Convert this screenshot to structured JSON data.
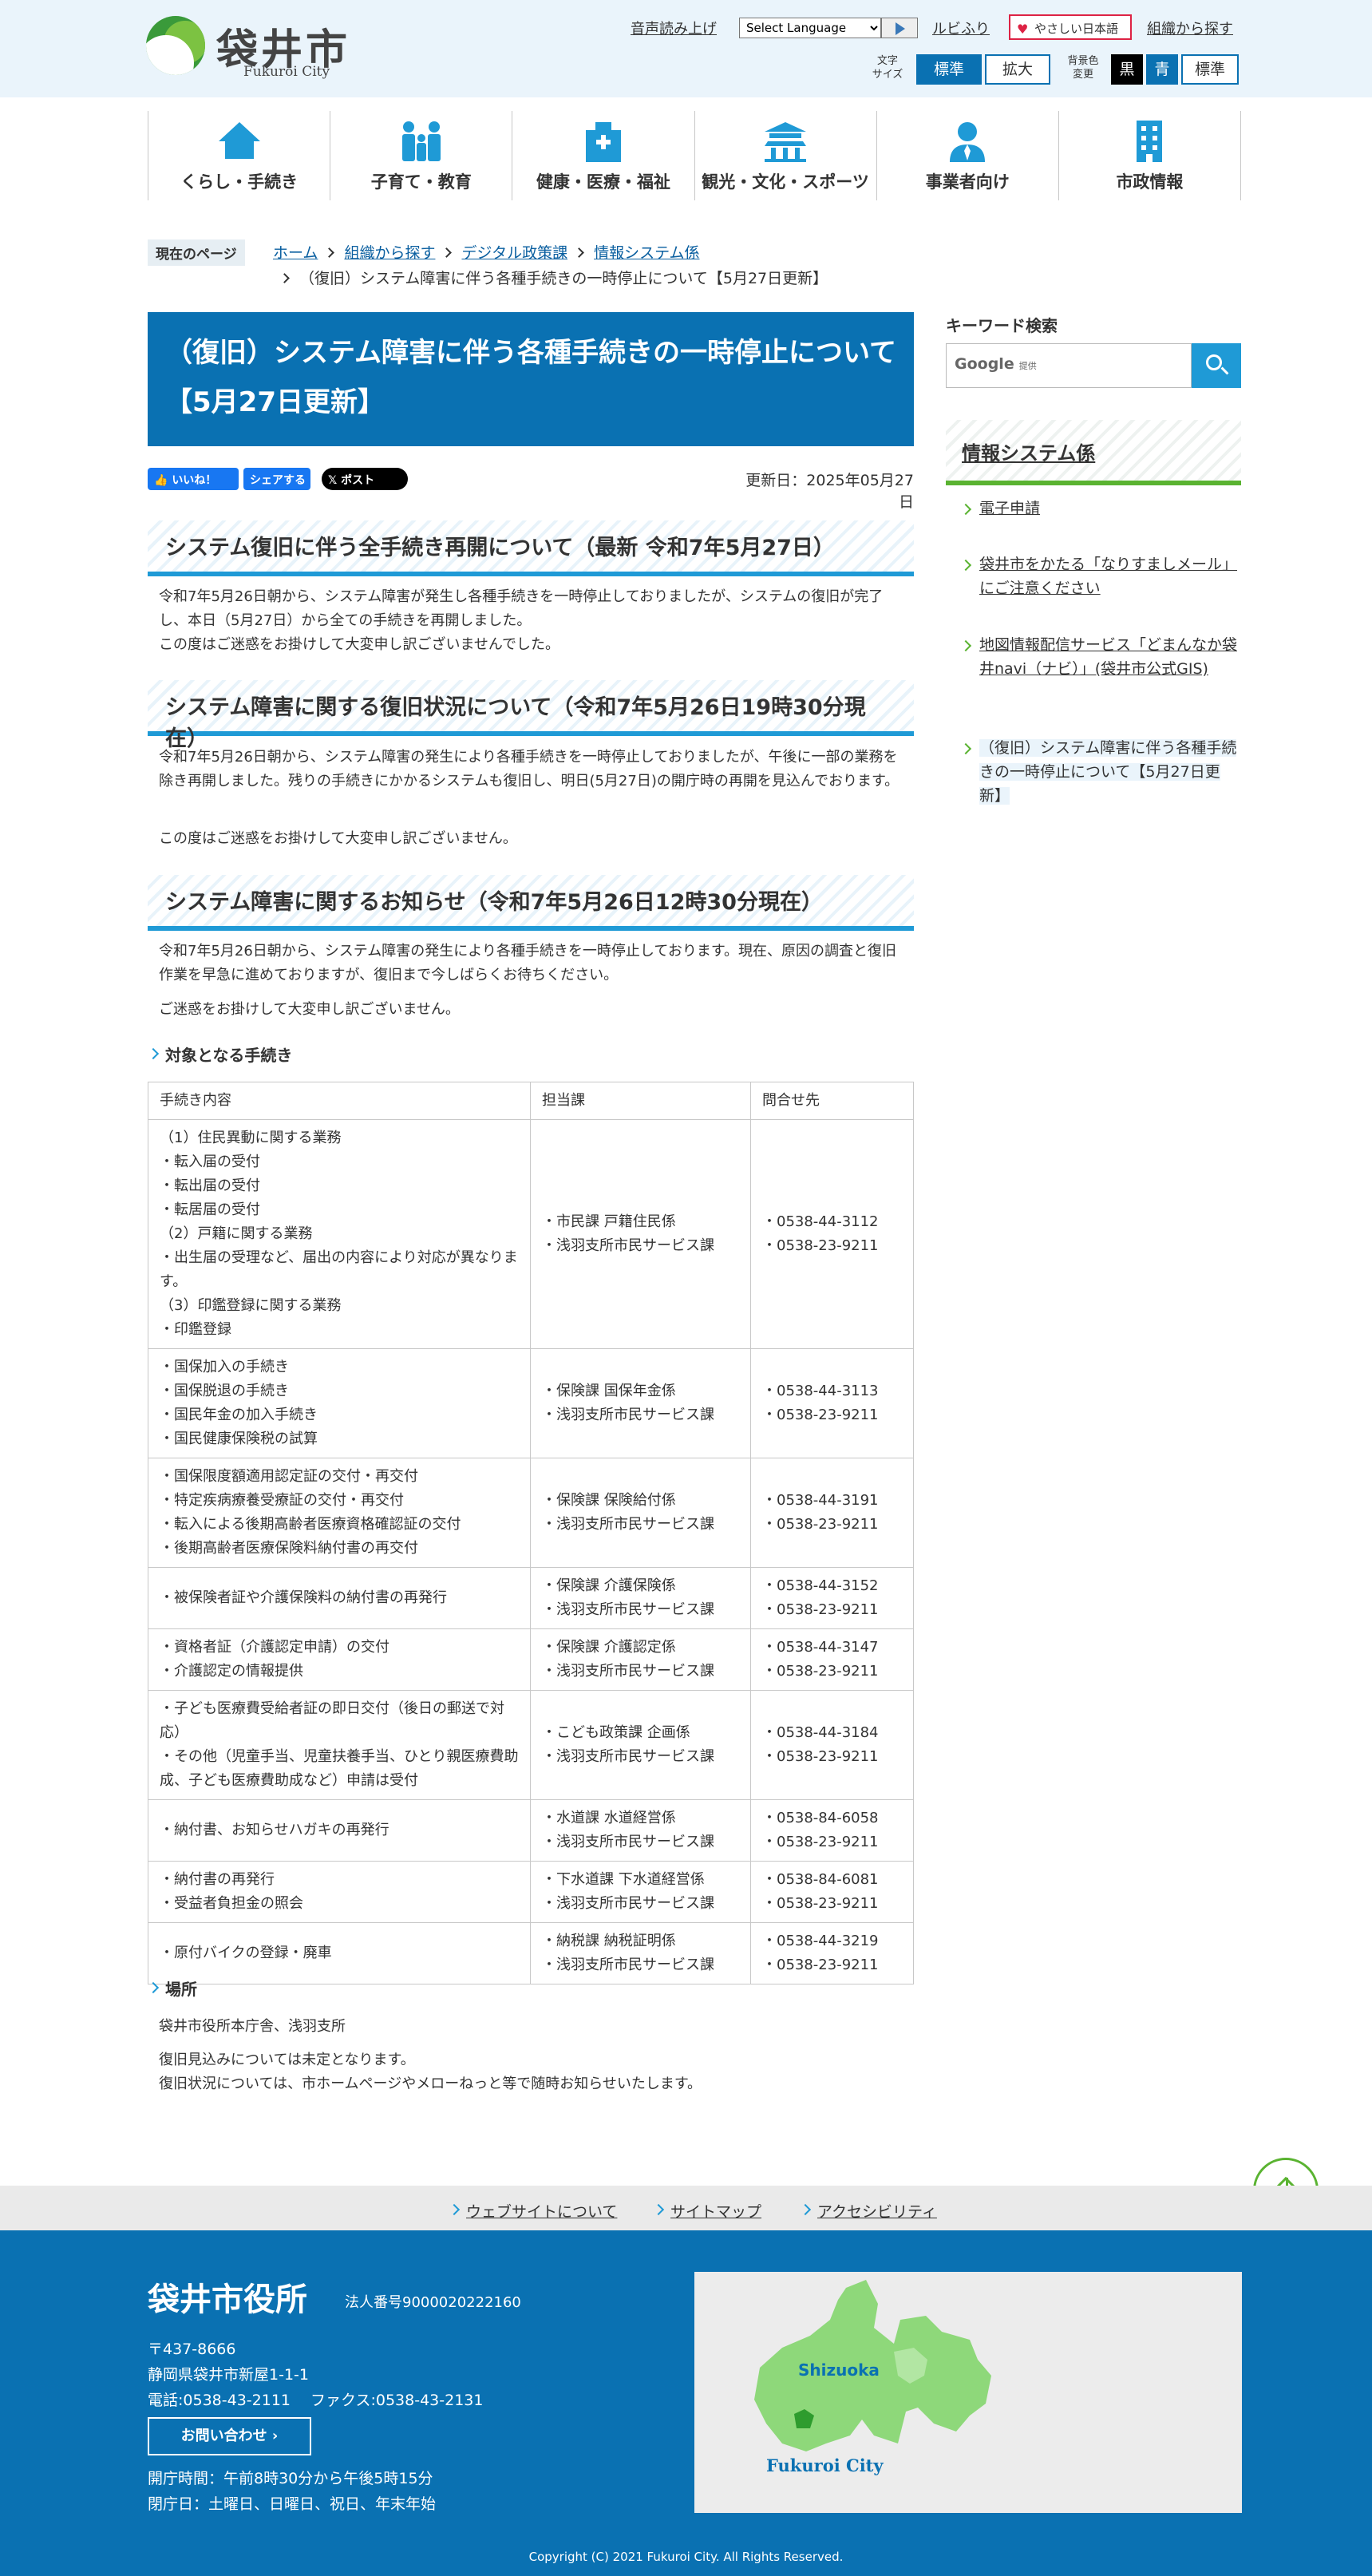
{
  "header": {
    "logo_name": "袋井市",
    "logo_sub": "Fukuroi City",
    "voice": "音声読み上げ",
    "language_select": "Select Language",
    "ruby": "ルビふり",
    "yasashii": "やさしい日本語",
    "org_search": "組織から探す",
    "font_size_label": "文字\nサイズ",
    "font_standard": "標準",
    "font_large": "拡大",
    "bg_label": "背景色\n変更",
    "bg_black": "黒",
    "bg_blue": "青",
    "bg_standard": "標準"
  },
  "nav": [
    {
      "label": "くらし・手続き",
      "icon": "house-icon"
    },
    {
      "label": "子育て・教育",
      "icon": "family-icon"
    },
    {
      "label": "健康・医療・福祉",
      "icon": "hospital-icon"
    },
    {
      "label": "観光・文化・スポーツ",
      "icon": "temple-icon"
    },
    {
      "label": "事業者向け",
      "icon": "businessperson-icon"
    },
    {
      "label": "市政情報",
      "icon": "building-icon"
    }
  ],
  "breadcrumb": {
    "tag": "現在のページ",
    "items": [
      "ホーム",
      "組織から探す",
      "デジタル政策課",
      "情報システム係"
    ],
    "current": "（復旧）システム障害に伴う各種手続きの一時停止について【5月27日更新】"
  },
  "page": {
    "title": "（復旧）システム障害に伴う各種手続きの一時停止について【5月27日更新】",
    "like": "いいね！",
    "share": "シェアする",
    "post": "ポスト",
    "updated": "更新日：2025年05月27日"
  },
  "sections": [
    {
      "heading": "システム復旧に伴う全手続き再開について（最新 令和7年5月27日）",
      "paragraphs": [
        "令和7年5月26日朝から、システム障害が発生し各種手続きを一時停止しておりましたが、システムの復旧が完了し、本日（5月27日）から全ての手続きを再開しました。\nこの度はご迷惑をお掛けして大変申し訳ございませんでした。"
      ]
    },
    {
      "heading": "システム障害に関する復旧状況について（令和7年5月26日19時30分現在）",
      "paragraphs": [
        "令和7年5月26日朝から、システム障害の発生により各種手続きを一時停止しておりましたが、午後に一部の業務を除き再開しました。残りの手続きにかかるシステムも復旧し、明日(5月27日)の開庁時の再開を見込んでおります。",
        "この度はご迷惑をお掛けして大変申し訳ございません。"
      ]
    },
    {
      "heading": "システム障害に関するお知らせ（令和7年5月26日12時30分現在）",
      "paragraphs": [
        "令和7年5月26日朝から、システム障害の発生により各種手続きを一時停止しております。現在、原因の調査と復旧作業を早急に進めておりますが、復旧まで今しばらくお待ちください。",
        "ご迷惑をお掛けして大変申し訳ございません。"
      ]
    }
  ],
  "procedures": {
    "heading": "対象となる手続き",
    "columns": [
      "手続き内容",
      "担当課",
      "問合せ先"
    ],
    "rows": [
      {
        "content": "（1）住民異動に関する業務\n・転入届の受付\n・転出届の受付\n・転居届の受付\n（2）戸籍に関する業務\n・出生届の受理など、届出の内容により対応が異なります。\n（3）印鑑登録に関する業務\n・印鑑登録",
        "dept": "・市民課 戸籍住民係\n・浅羽支所市民サービス課",
        "tel": "・0538-44-3112\n・0538-23-9211"
      },
      {
        "content": "・国保加入の手続き\n・国保脱退の手続き\n・国民年金の加入手続き\n・国民健康保険税の試算",
        "dept": "・保険課 国保年金係\n・浅羽支所市民サービス課",
        "tel": "・0538-44-3113\n・0538-23-9211"
      },
      {
        "content": "・国保限度額適用認定証の交付・再交付\n・特定疾病療養受療証の交付・再交付\n・転入による後期高齢者医療資格確認証の交付\n・後期高齢者医療保険料納付書の再交付",
        "dept": "・保険課 保険給付係\n・浅羽支所市民サービス課",
        "tel": "・0538-44-3191\n・0538-23-9211"
      },
      {
        "content": "・被保険者証や介護保険料の納付書の再発行",
        "dept": "・保険課 介護保険係\n・浅羽支所市民サービス課",
        "tel": "・0538-44-3152\n・0538-23-9211"
      },
      {
        "content": "・資格者証（介護認定申請）の交付\n・介護認定の情報提供",
        "dept": "・保険課 介護認定係\n・浅羽支所市民サービス課",
        "tel": "・0538-44-3147\n・0538-23-9211"
      },
      {
        "content": "・子ども医療費受給者証の即日交付（後日の郵送で対応）\n・その他（児童手当、児童扶養手当、ひとり親医療費助成、子ども医療費助成など）申請は受付",
        "dept": "・こども政策課 企画係\n・浅羽支所市民サービス課",
        "tel": "・0538-44-3184\n・0538-23-9211"
      },
      {
        "content": "・納付書、お知らせハガキの再発行",
        "dept": "・水道課 水道経営係\n・浅羽支所市民サービス課",
        "tel": "・0538-84-6058\n・0538-23-9211"
      },
      {
        "content": "・納付書の再発行\n・受益者負担金の照会",
        "dept": "・下水道課 下水道経営係\n・浅羽支所市民サービス課",
        "tel": "・0538-84-6081\n・0538-23-9211"
      },
      {
        "content": "・原付バイクの登録・廃車",
        "dept": "・納税課 納税証明係\n・浅羽支所市民サービス課",
        "tel": "・0538-44-3219\n・0538-23-9211"
      }
    ]
  },
  "place": {
    "heading": "場所",
    "text": "袋井市役所本庁舎、浅羽支所",
    "note": "復旧見込みについては未定となります。\n復旧状況については、市ホームページやメローねっと等で随時お知らせいたします。"
  },
  "sidebar": {
    "keyword_label": "キーワード検索",
    "search_google": "Google",
    "search_provided": "提供",
    "section_title": "情報システム係",
    "links": [
      "電子申請",
      "袋井市をかたる「なりすましメール」にご注意ください",
      "地図情報配信サービス「どまんなか袋井navi（ナビ）」(袋井市公式GIS)",
      "（復旧）システム障害に伴う各種手続きの一時停止について【5月27日更新】"
    ]
  },
  "footer": {
    "links": [
      "ウェブサイトについて",
      "サイトマップ",
      "アクセシビリティ"
    ],
    "office": "袋井市役所",
    "corp_number": "法人番号9000020222160",
    "postal": "〒437-8666",
    "address": "静岡県袋井市新屋1-1-1",
    "phone": "電話:0538-43-2111　 ファクス:0538-43-2131",
    "contact": "お問い合わせ",
    "hours": "開庁時間：午前8時30分から午後5時15分",
    "closed": "閉庁日：土曜日、日曜日、祝日、年末年始",
    "map_pref": "Shizuoka",
    "map_city": "Fukuroi City",
    "copyright": "Copyright (C) 2021 Fukuroi City. All Rights Reserved."
  },
  "colors": {
    "primary": "#0a71b2",
    "accent": "#1f9ad6",
    "green": "#5ab331"
  }
}
